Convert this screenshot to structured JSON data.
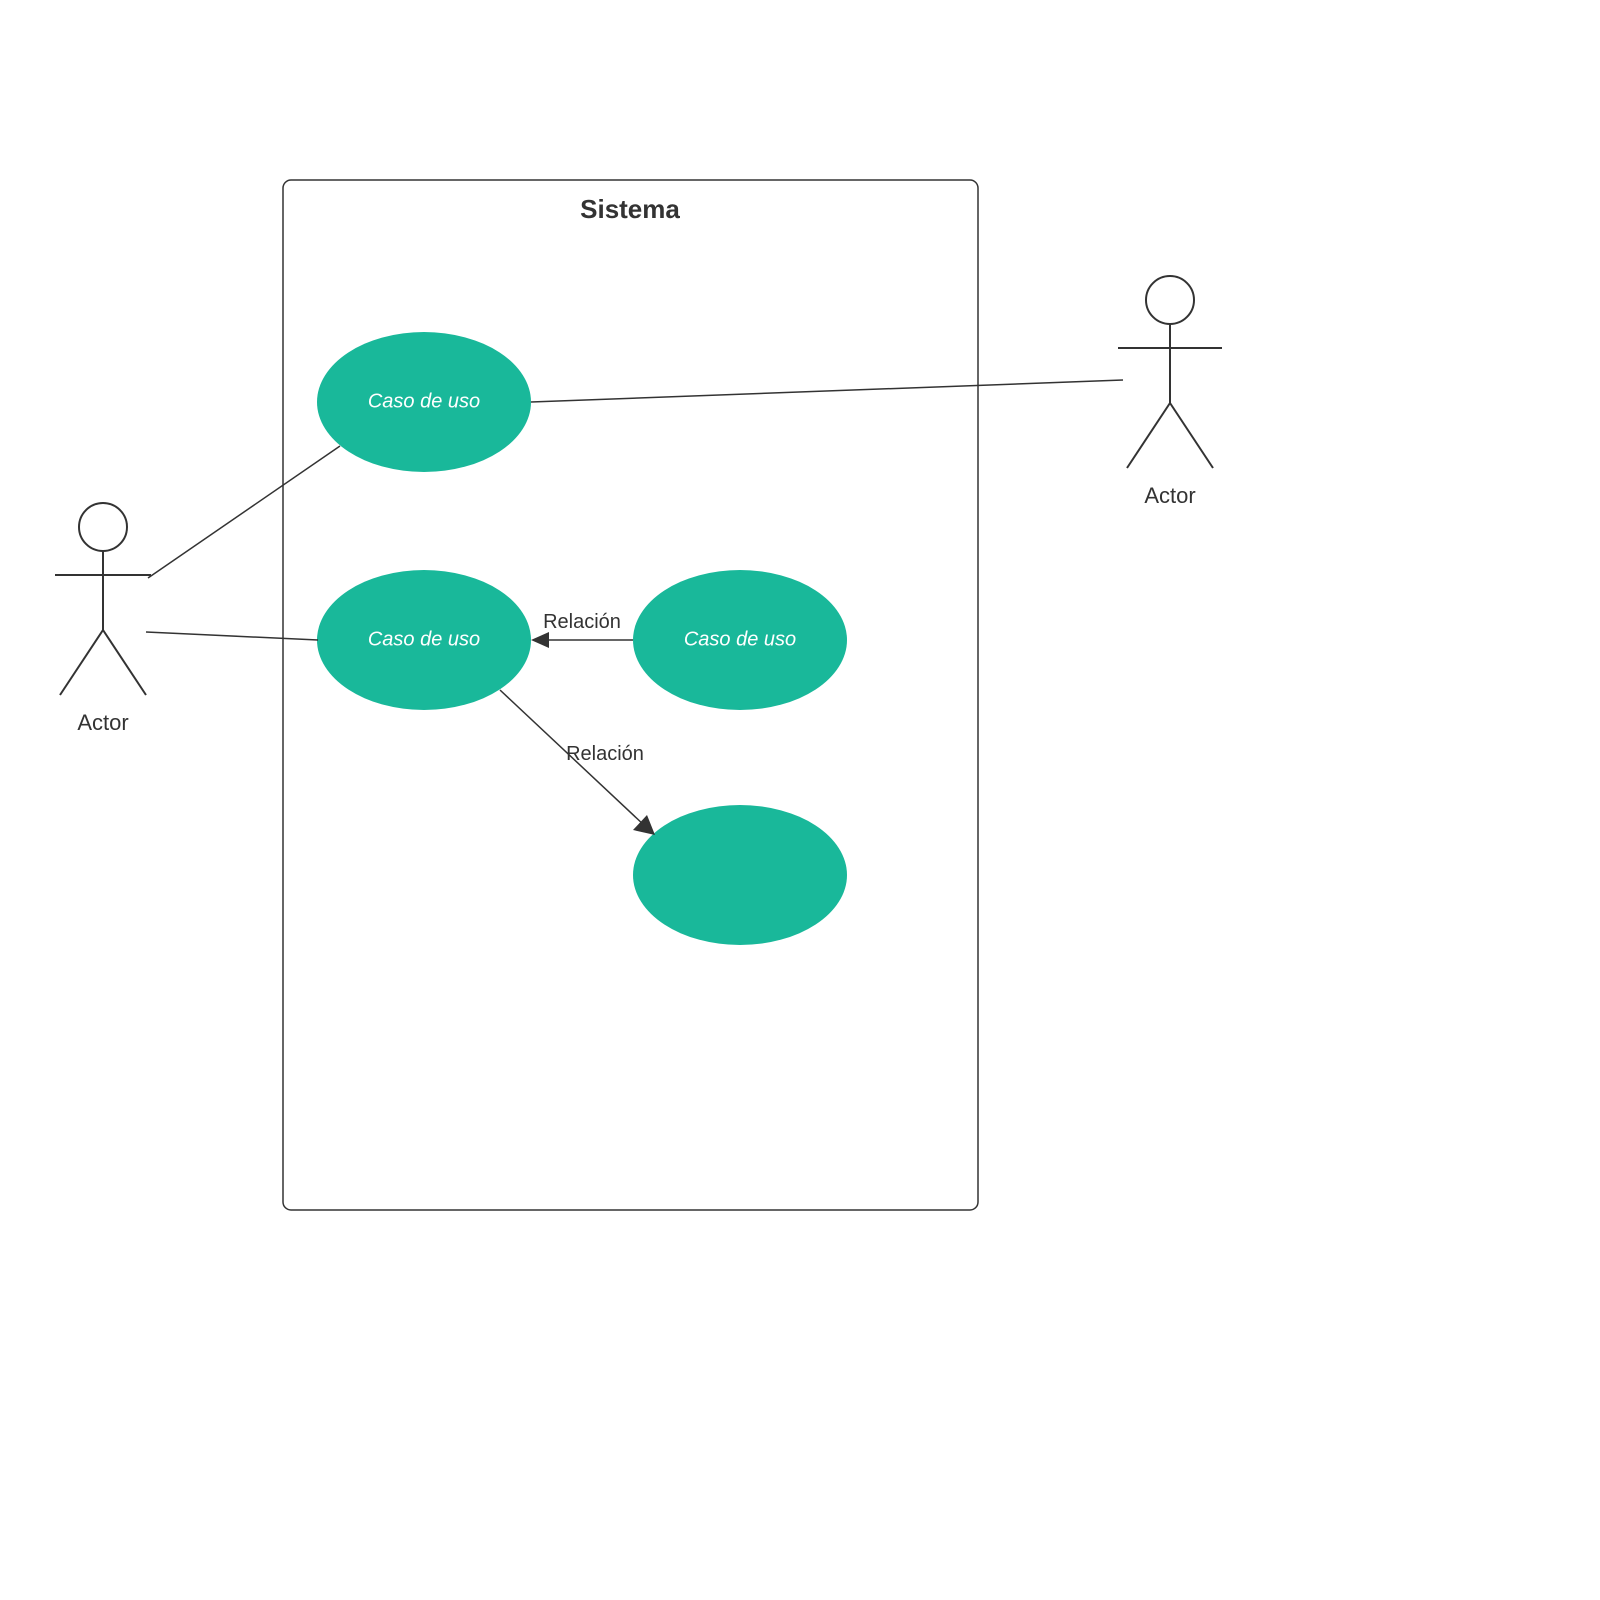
{
  "system": {
    "title": "Sistema"
  },
  "actors": {
    "left": {
      "label": "Actor"
    },
    "right": {
      "label": "Actor"
    }
  },
  "usecases": {
    "uc1": {
      "label": "Caso de uso"
    },
    "uc2": {
      "label": "Caso de uso"
    },
    "uc3": {
      "label": "Caso de uso"
    },
    "uc4": {
      "label": ""
    }
  },
  "relations": {
    "r1": {
      "label": "Relación"
    },
    "r2": {
      "label": "Relación"
    }
  },
  "colors": {
    "usecase_fill": "#19b89a",
    "stroke": "#333333"
  }
}
